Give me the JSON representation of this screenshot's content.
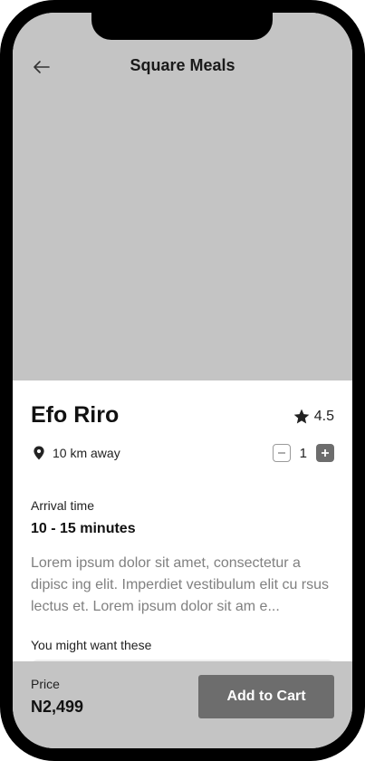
{
  "header": {
    "title": "Square Meals",
    "back_icon": "arrow-left-icon"
  },
  "dish": {
    "name": "Efo Riro",
    "rating": "4.5",
    "rating_icon": "star-icon",
    "location": "10 km away",
    "location_icon": "location-pin-icon",
    "quantity": "1"
  },
  "arrival": {
    "label": "Arrival time",
    "value": "10 - 15 minutes"
  },
  "description": "Lorem ipsum dolor sit amet, consectetur a dipisc ing elit. Imperdiet vestibulum elit cu rsus lectus et. Lorem ipsum dolor sit am e...",
  "suggestions": {
    "label": "You might want these"
  },
  "footer": {
    "price_label": "Price",
    "price_value": "N2,499",
    "cart_label": "Add to Cart"
  },
  "colors": {
    "hero": "#c4c4c4",
    "button": "#6d6d6d",
    "muted_text": "#808080"
  }
}
